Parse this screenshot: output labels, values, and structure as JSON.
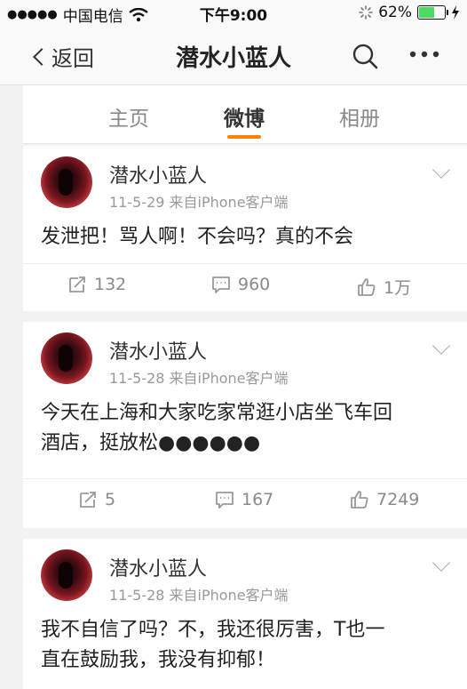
{
  "status": {
    "carrier": "中国电信",
    "time": "下午9:00",
    "battery": "62%",
    "battery_level": 0.62,
    "accent": "#4cd964"
  },
  "nav": {
    "back_label": "返回",
    "title": "潜水小蓝人",
    "search_icon": "search-icon",
    "more_icon": "more-icon"
  },
  "tabs": [
    {
      "label": "主页"
    },
    {
      "label": "微博"
    },
    {
      "label": "相册"
    }
  ],
  "active_tab_color": "#ff8200",
  "posts": [
    {
      "author": "潜水小蓝人",
      "meta": "11-5-29 来自iPhone客户端",
      "lines": [
        "发泄把！骂人啊！不会吗？真的不会"
      ],
      "reposts": "132",
      "comments": "960",
      "likes": "1万"
    },
    {
      "author": "潜水小蓝人",
      "meta": "11-5-28 来自iPhone客户端",
      "lines": [
        "今天在上海和大家吃家常逛小店坐飞车回",
        "酒店，挺放松●●●●●●"
      ],
      "reposts": "5",
      "comments": "167",
      "likes": "7249"
    },
    {
      "author": "潜水小蓝人",
      "meta": "11-5-28 来自iPhone客户端",
      "lines": [
        "我不自信了吗？不，我还很厉害，T也一",
        "直在鼓励我，我没有抑郁！"
      ]
    }
  ]
}
